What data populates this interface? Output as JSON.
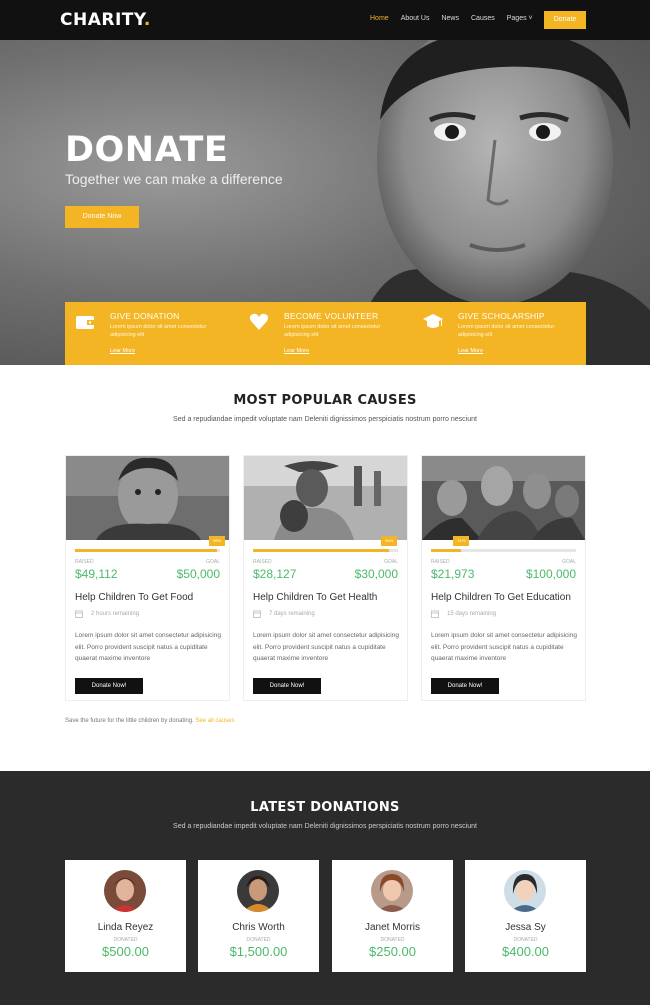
{
  "brand": {
    "name": "CHARITY",
    "dot": ".",
    "accent": "#f4b524",
    "green": "#4cb96a"
  },
  "nav": {
    "items": [
      {
        "label": "Home",
        "active": true
      },
      {
        "label": "About Us"
      },
      {
        "label": "News"
      },
      {
        "label": "Causes"
      },
      {
        "label": "Pages ˅"
      }
    ],
    "donate_label": "Donate"
  },
  "hero": {
    "title": "DONATE",
    "subtitle": "Together we can make a difference",
    "button": "Donate Now"
  },
  "features": [
    {
      "icon": "wallet-icon",
      "title": "GIVE DONATION",
      "text": "Lorem ipsum dolor sit amet consectetur adipisicing elit",
      "link": "Lear More"
    },
    {
      "icon": "heart-icon",
      "title": "BECOME VOLUNTEER",
      "text": "Lorem ipsum dolor sit amet consectetur adipisicing elit",
      "link": "Lear More"
    },
    {
      "icon": "graduation-cap-icon",
      "title": "GIVE SCHOLARSHIP",
      "text": "Lorem ipsum dolor sit amet consectetur adipisicing elit",
      "link": "Lear More"
    }
  ],
  "causes": {
    "title": "MOST POPULAR CAUSES",
    "subtitle": "Sed a repudiandae impedit voluptate nam Deleniti dignissimos perspiciatis nostrum porro nesciunt",
    "raised_label": "RAISED",
    "goal_label": "GOAL",
    "button": "Donate Now!",
    "desc": "Lorem ipsum dolor sit amet consectetur adipisicing elit. Porro provident suscipit natus a cupiditate quaerat maxime inventore",
    "items": [
      {
        "name": "Help Children To Get Food",
        "raised": "$49,112",
        "goal": "$50,000",
        "progress": 0.98,
        "pct_label": "98%",
        "time": "2 hours remaining"
      },
      {
        "name": "Help Children To Get Health",
        "raised": "$28,127",
        "goal": "$30,000",
        "progress": 0.94,
        "pct_label": "94%",
        "time": "7 days remaining"
      },
      {
        "name": "Help Children To Get Education",
        "raised": "$21,973",
        "goal": "$100,000",
        "progress": 0.21,
        "pct_label": "21%",
        "time": "15 days remaining"
      }
    ],
    "footnote": "Save the future for the little children by donating.",
    "footnote_link": "See all causes"
  },
  "donations": {
    "title": "LATEST DONATIONS",
    "subtitle": "Sed a repudiandae impedit voluptate nam Deleniti dignissimos perspiciatis nostrum porro nesciunt",
    "label": "DONATED",
    "items": [
      {
        "name": "Linda Reyez",
        "amount": "$500.00"
      },
      {
        "name": "Chris Worth",
        "amount": "$1,500.00"
      },
      {
        "name": "Janet Morris",
        "amount": "$250.00"
      },
      {
        "name": "Jessa Sy",
        "amount": "$400.00"
      }
    ]
  }
}
